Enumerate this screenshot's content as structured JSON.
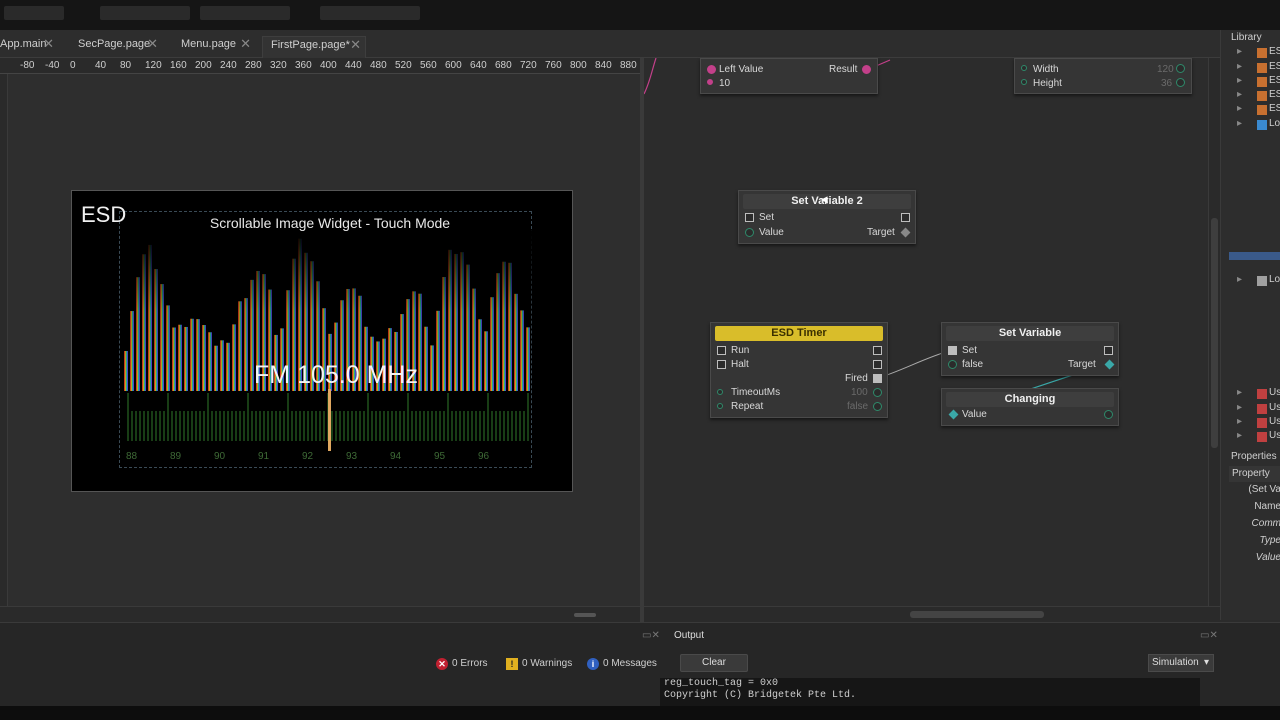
{
  "tabs": [
    {
      "label": "App.main",
      "close": "✕"
    },
    {
      "label": "SecPage.page",
      "close": "✕"
    },
    {
      "label": "Menu.page",
      "close": "✕"
    },
    {
      "label": "FirstPage.page*",
      "close": "✕",
      "active": true
    }
  ],
  "ruler_ticks": [
    "-80",
    "-40",
    "0",
    "40",
    "80",
    "120",
    "160",
    "200",
    "240",
    "280",
    "320",
    "360",
    "400",
    "440",
    "480",
    "520",
    "560",
    "600",
    "640",
    "680",
    "720",
    "760",
    "800",
    "840",
    "880"
  ],
  "screen": {
    "logo": "ESD",
    "title": "Scrollable Image Widget - Touch Mode",
    "frequency": "FM 105.0 MHz",
    "scale_ticks": [
      "88",
      "89",
      "90",
      "91",
      "92",
      "93",
      "94",
      "95",
      "96"
    ]
  },
  "nodes": {
    "compare": {
      "left_value": "Left Value",
      "result": "Result",
      "value": "10"
    },
    "size": {
      "width_label": "Width",
      "width_value": "120",
      "height_label": "Height",
      "height_value": "36"
    },
    "set_variable_2": {
      "title": "Set Variable 2",
      "set": "Set",
      "value": "Value",
      "target": "Target"
    },
    "timer": {
      "title": "ESD Timer",
      "run": "Run",
      "halt": "Halt",
      "fired": "Fired",
      "timeout": "TimeoutMs",
      "timeout_value": "100",
      "repeat": "Repeat",
      "repeat_value": "false"
    },
    "set_variable": {
      "title": "Set Variable",
      "set": "Set",
      "value": "false",
      "target": "Target"
    },
    "changing": {
      "title": "Changing",
      "value": "Value"
    }
  },
  "library": {
    "title": "Library",
    "items": [
      "ES",
      "ES",
      "ES",
      "ES",
      "ES",
      "Lo",
      "Lo",
      "Us",
      "Us",
      "Us",
      "Us"
    ]
  },
  "properties": {
    "title": "Properties",
    "header": "Property",
    "rows": [
      "(Set Va",
      "Name",
      "Comm",
      "Type",
      "Value"
    ]
  },
  "output": {
    "title": "Output",
    "errors": "0 Errors",
    "warnings": "0 Warnings",
    "messages": "0 Messages",
    "clear": "Clear",
    "mode": "Simulation",
    "console_lines": [
      "reg_touch_tag = 0x0",
      "Copyright (C) Bridgetek Pte Ltd."
    ]
  },
  "colors": {
    "accent_yellow": "#d9bd2a",
    "pin_pink": "#c3408a",
    "pin_green": "#2e8a6a",
    "link_teal": "#3aa8a8"
  }
}
